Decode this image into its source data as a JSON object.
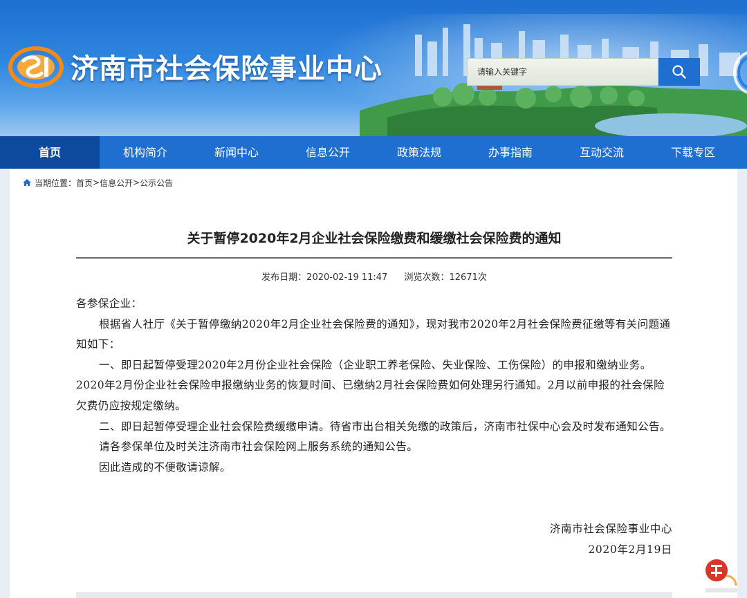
{
  "header": {
    "site_title": "济南市社会保险事业中心",
    "logo_text": "SI",
    "search_placeholder": "请输入关键字"
  },
  "nav": {
    "items": [
      {
        "label": "首页",
        "active": true
      },
      {
        "label": "机构简介"
      },
      {
        "label": "新闻中心"
      },
      {
        "label": "信息公开"
      },
      {
        "label": "政策法规"
      },
      {
        "label": "办事指南"
      },
      {
        "label": "互动交流"
      },
      {
        "label": "下载专区"
      }
    ]
  },
  "breadcrumb": {
    "prefix": "当期位置：",
    "items": [
      "首页",
      "信息公开",
      "公示公告"
    ],
    "separator": ">"
  },
  "article": {
    "title": "关于暂停2020年2月企业社会保险缴费和缓缴社会保险费的通知",
    "publish_label": "发布日期：",
    "publish_date": "2020-02-19 11:47",
    "views_label": "浏览次数：",
    "views": "12671次",
    "paragraphs": [
      "各参保企业：",
      "根据省人社厅《关于暂停缴纳2020年2月企业社会保险费的通知》，现对我市2020年2月社会保险费征缴等有关问题通知如下：",
      "一、即日起暂停受理2020年2月份企业社会保险（企业职工养老保险、失业保险、工伤保险）的申报和缴纳业务。2020年2月份企业社会保险申报缴纳业务的恢复时间、已缴纳2月社会保险费如何处理另行通知。2月以前申报的社会保险欠费仍应按规定缴纳。",
      "二、即日起暂停受理企业社会保险费缓缴申请。待省市出台相关免缴的政策后，济南市社保中心会及时发布通知公告。",
      "请各参保单位及时关注济南市社会保险网上服务系统的通知公告。",
      "因此造成的不便敬请谅解。"
    ],
    "signature_org": "济南市社会保险事业中心",
    "signature_date": "2020年2月19日"
  },
  "colors": {
    "nav_bg": "#1f6fd1",
    "nav_active_bg": "#0d4a9e",
    "logo_orange": "#f28a1a",
    "watermark_red": "#d9362b"
  },
  "icons": [
    "si-logo-icon",
    "search-icon",
    "home-icon",
    "watermark-stamp-icon"
  ]
}
